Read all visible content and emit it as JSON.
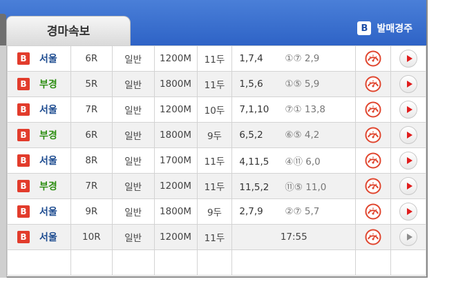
{
  "tab_label": "경마속보",
  "header_link": {
    "badge": "B",
    "label": "발매경주"
  },
  "colors": {
    "seoul": "#1b4a8f",
    "busan": "#2f8f14",
    "badge": "#e23c2c",
    "header": "#2e63c6"
  },
  "rows": [
    {
      "badge": "B",
      "location": "서울",
      "loc_key": "seoul",
      "race": "6R",
      "grade": "일반",
      "distance": "1200M",
      "runners": "11두",
      "result": "1,7,4",
      "payout": "①⑦ 2,9",
      "time": "",
      "play_active": true
    },
    {
      "badge": "B",
      "location": "부경",
      "loc_key": "busan",
      "race": "5R",
      "grade": "일반",
      "distance": "1800M",
      "runners": "11두",
      "result": "1,5,6",
      "payout": "①⑤ 5,9",
      "time": "",
      "play_active": true
    },
    {
      "badge": "B",
      "location": "서울",
      "loc_key": "seoul",
      "race": "7R",
      "grade": "일반",
      "distance": "1200M",
      "runners": "10두",
      "result": "7,1,10",
      "payout": "⑦① 13,8",
      "time": "",
      "play_active": true
    },
    {
      "badge": "B",
      "location": "부경",
      "loc_key": "busan",
      "race": "6R",
      "grade": "일반",
      "distance": "1800M",
      "runners": "9두",
      "result": "6,5,2",
      "payout": "⑥⑤ 4,2",
      "time": "",
      "play_active": true
    },
    {
      "badge": "B",
      "location": "서울",
      "loc_key": "seoul",
      "race": "8R",
      "grade": "일반",
      "distance": "1700M",
      "runners": "11두",
      "result": "4,11,5",
      "payout": "④⑪ 6,0",
      "time": "",
      "play_active": true
    },
    {
      "badge": "B",
      "location": "부경",
      "loc_key": "busan",
      "race": "7R",
      "grade": "일반",
      "distance": "1200M",
      "runners": "11두",
      "result": "11,5,2",
      "payout": "⑪⑤ 11,0",
      "time": "",
      "play_active": true
    },
    {
      "badge": "B",
      "location": "서울",
      "loc_key": "seoul",
      "race": "9R",
      "grade": "일반",
      "distance": "1800M",
      "runners": "9두",
      "result": "2,7,9",
      "payout": "②⑦ 5,7",
      "time": "",
      "play_active": true
    },
    {
      "badge": "B",
      "location": "서울",
      "loc_key": "seoul",
      "race": "10R",
      "grade": "일반",
      "distance": "1200M",
      "runners": "11두",
      "result": "",
      "payout": "",
      "time": "17:55",
      "play_active": false
    }
  ]
}
